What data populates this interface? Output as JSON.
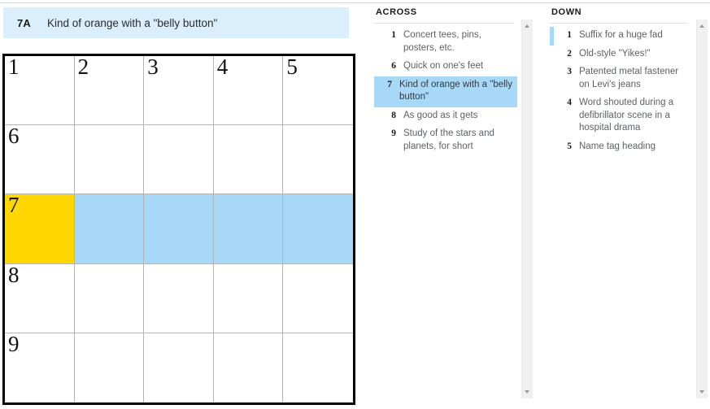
{
  "current_clue": {
    "number_label": "7A",
    "text": "Kind of orange with a \"belly button\""
  },
  "grid": {
    "rows": 5,
    "cols": 5,
    "colors": {
      "cursor_cell": "#ffd700",
      "active_word": "#a7d8f8",
      "cell_border": "#b4b4b4",
      "grid_border": "#000000"
    },
    "cells": [
      [
        {
          "number": "1",
          "letter": "",
          "state": "normal"
        },
        {
          "number": "2",
          "letter": "",
          "state": "normal"
        },
        {
          "number": "3",
          "letter": "",
          "state": "normal"
        },
        {
          "number": "4",
          "letter": "",
          "state": "normal"
        },
        {
          "number": "5",
          "letter": "",
          "state": "normal"
        }
      ],
      [
        {
          "number": "6",
          "letter": "",
          "state": "normal"
        },
        {
          "number": "",
          "letter": "",
          "state": "normal"
        },
        {
          "number": "",
          "letter": "",
          "state": "normal"
        },
        {
          "number": "",
          "letter": "",
          "state": "normal"
        },
        {
          "number": "",
          "letter": "",
          "state": "normal"
        }
      ],
      [
        {
          "number": "7",
          "letter": "",
          "state": "cursor"
        },
        {
          "number": "",
          "letter": "",
          "state": "active"
        },
        {
          "number": "",
          "letter": "",
          "state": "active"
        },
        {
          "number": "",
          "letter": "",
          "state": "active"
        },
        {
          "number": "",
          "letter": "",
          "state": "active"
        }
      ],
      [
        {
          "number": "8",
          "letter": "",
          "state": "normal"
        },
        {
          "number": "",
          "letter": "",
          "state": "normal"
        },
        {
          "number": "",
          "letter": "",
          "state": "normal"
        },
        {
          "number": "",
          "letter": "",
          "state": "normal"
        },
        {
          "number": "",
          "letter": "",
          "state": "normal"
        }
      ],
      [
        {
          "number": "9",
          "letter": "",
          "state": "normal"
        },
        {
          "number": "",
          "letter": "",
          "state": "normal"
        },
        {
          "number": "",
          "letter": "",
          "state": "normal"
        },
        {
          "number": "",
          "letter": "",
          "state": "normal"
        },
        {
          "number": "",
          "letter": "",
          "state": "normal"
        }
      ]
    ]
  },
  "across": {
    "heading": "ACROSS",
    "clues": [
      {
        "number": "1",
        "text": "Concert tees, pins, posters, etc.",
        "state": "plain"
      },
      {
        "number": "6",
        "text": "Quick on one's feet",
        "state": "plain"
      },
      {
        "number": "7",
        "text": "Kind of orange with a \"belly button\"",
        "state": "selected"
      },
      {
        "number": "8",
        "text": "As good as it gets",
        "state": "plain"
      },
      {
        "number": "9",
        "text": "Study of the stars and planets, for short",
        "state": "plain"
      }
    ]
  },
  "down": {
    "heading": "DOWN",
    "clues": [
      {
        "number": "1",
        "text": "Suffix for a huge fad",
        "state": "marked"
      },
      {
        "number": "2",
        "text": "Old-style \"Yikes!\"",
        "state": "plain"
      },
      {
        "number": "3",
        "text": "Patented metal fastener on Levi's jeans",
        "state": "plain"
      },
      {
        "number": "4",
        "text": "Word shouted during a defibrillator scene in a hospital drama",
        "state": "plain"
      },
      {
        "number": "5",
        "text": "Name tag heading",
        "state": "plain"
      }
    ]
  },
  "scrollbars": {
    "up_arrow_icon": "triangle-up-icon",
    "down_arrow_icon": "triangle-down-icon"
  }
}
